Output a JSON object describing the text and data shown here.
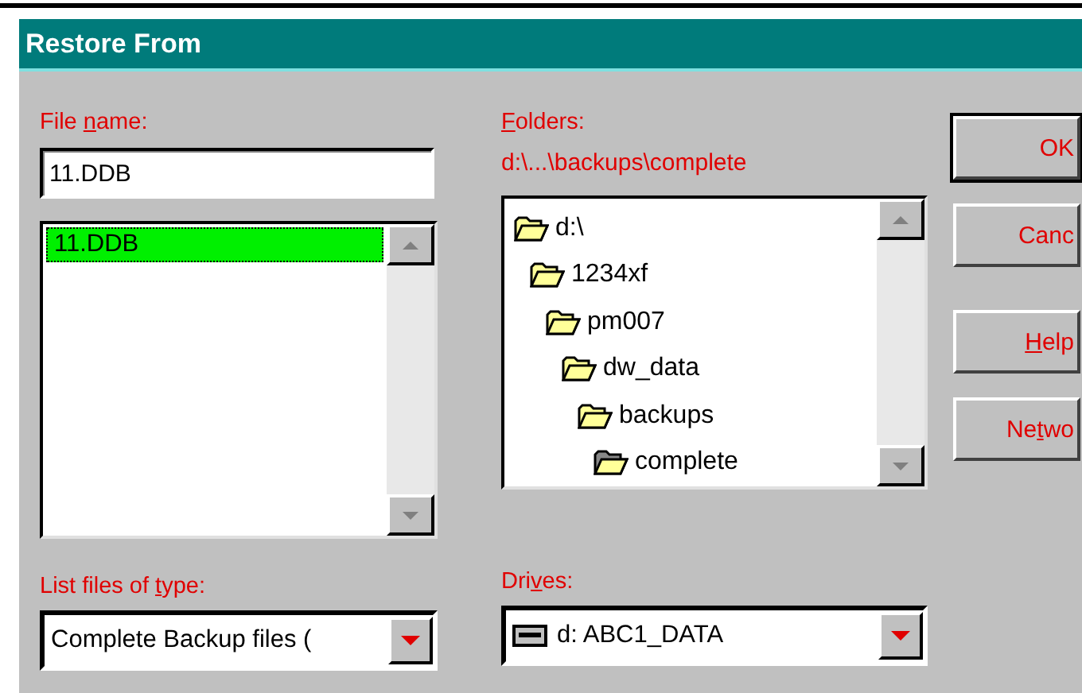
{
  "window": {
    "title": "Restore From"
  },
  "file_name": {
    "label": {
      "pre": "File ",
      "key": "n",
      "post": "ame:"
    },
    "value": "11.DDB"
  },
  "files": [
    {
      "name": "11.DDB",
      "selected": true
    }
  ],
  "file_type": {
    "label": {
      "pre": "List files of ",
      "key": "t",
      "post": "ype:"
    },
    "value": "Complete Backup files ("
  },
  "folders": {
    "label": {
      "key": "F",
      "post": "olders:"
    },
    "path": "d:\\...\\backups\\complete",
    "tree": [
      {
        "name": "d:\\",
        "selected": false,
        "children": [
          {
            "name": "1234xf",
            "selected": false,
            "children": [
              {
                "name": "pm007",
                "selected": false,
                "children": [
                  {
                    "name": "dw_data",
                    "selected": false,
                    "children": [
                      {
                        "name": "backups",
                        "selected": false,
                        "children": [
                          {
                            "name": "complete",
                            "selected": true
                          }
                        ]
                      }
                    ]
                  }
                ]
              }
            ]
          }
        ]
      }
    ]
  },
  "drives": {
    "label": {
      "pre": "Dri",
      "key": "v",
      "post": "es:"
    },
    "value": "d: ABC1_DATA"
  },
  "buttons": [
    {
      "label": {
        "pre": "OK"
      },
      "default": true
    },
    {
      "label": {
        "pre": "Canc"
      },
      "default": false
    },
    {
      "label": {
        "key": "H",
        "post": "elp"
      },
      "default": false
    },
    {
      "label": {
        "pre": "Ne",
        "key": "t",
        "post": "wo"
      },
      "default": false
    }
  ]
}
